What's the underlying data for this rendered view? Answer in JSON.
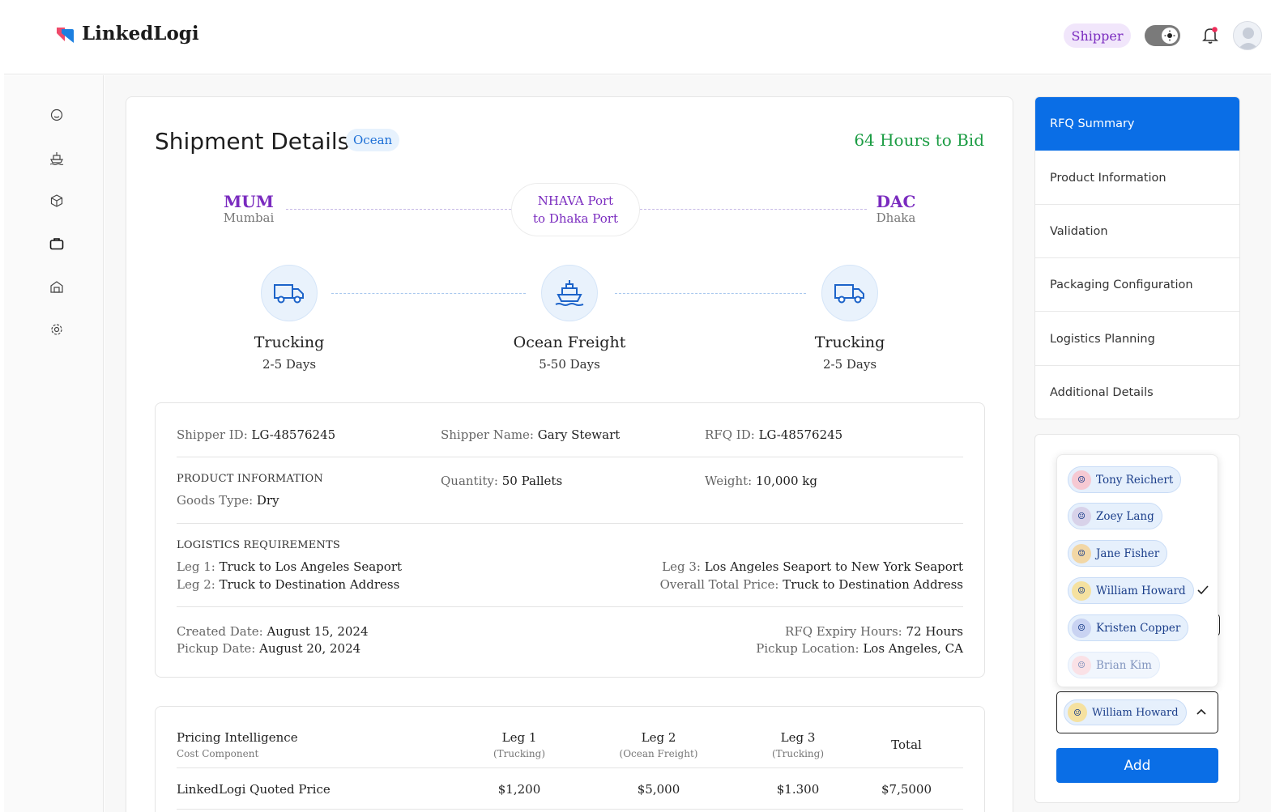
{
  "app": {
    "name": "LinkedLogi"
  },
  "header": {
    "role": "Shipper"
  },
  "shipment": {
    "title": "Shipment Details",
    "mode": "Ocean",
    "bid_timer": "64 Hours to Bid",
    "origin": {
      "code": "MUM",
      "city": "Mumbai"
    },
    "destination": {
      "code": "DAC",
      "city": "Dhaka"
    },
    "port_line1": "NHAVA Port",
    "port_line2": "to Dhaka Port",
    "legs": [
      {
        "name": "Trucking",
        "days": "2-5 Days",
        "icon": "truck-icon"
      },
      {
        "name": "Ocean Freight",
        "days": "5-50 Days",
        "icon": "ship-icon"
      },
      {
        "name": "Trucking",
        "days": "2-5 Days",
        "icon": "truck-icon"
      }
    ]
  },
  "info": {
    "shipper_id_label": "Shipper ID:",
    "shipper_id": "LG-48576245",
    "shipper_name_label": "Shipper Name:",
    "shipper_name": "Gary Stewart",
    "rfq_id_label": "RFQ ID:",
    "rfq_id": "LG-48576245",
    "product_heading": "PRODUCT INFORMATION",
    "goods_type_label": "Goods Type:",
    "goods_type": "Dry",
    "quantity_label": "Quantity:",
    "quantity": "50 Pallets",
    "weight_label": "Weight:",
    "weight": "10,000 kg",
    "logistics_heading": "LOGISTICS REQUIREMENTS",
    "leg1_label": "Leg 1:",
    "leg1": "Truck to Los Angeles Seaport",
    "leg2_label": "Leg 2:",
    "leg2": "Truck to Destination Address",
    "leg3_label": "Leg 3:",
    "leg3": "Los Angeles Seaport to New York Seaport",
    "overall_label": "Overall Total Price:",
    "overall": "Truck to Destination Address",
    "created_label": "Created Date:",
    "created": "August 15, 2024",
    "pickup_date_label": "Pickup Date:",
    "pickup_date": "August 20, 2024",
    "expiry_label": "RFQ Expiry Hours:",
    "expiry": "72 Hours",
    "pickup_loc_label": "Pickup Location:",
    "pickup_loc": "Los Angeles, CA"
  },
  "pricing": {
    "title": "Pricing Intelligence",
    "subtitle": "Cost Component",
    "columns": [
      {
        "label": "Leg 1",
        "sub": "(Trucking)"
      },
      {
        "label": "Leg 2",
        "sub": "(Ocean Freight)"
      },
      {
        "label": "Leg 3",
        "sub": "(Trucking)"
      },
      {
        "label": "Total",
        "sub": ""
      }
    ],
    "rows": [
      {
        "label": "LinkedLogi Quoted Price",
        "values": [
          "$1,200",
          "$5,000",
          "$1.300",
          "$7,5000"
        ]
      }
    ]
  },
  "nav": {
    "items": [
      "RFQ Summary",
      "Product Information",
      "Validation",
      "Packaging Configuration",
      "Logistics Planning",
      "Additional Details"
    ]
  },
  "assign": {
    "options": [
      "Tony Reichert",
      "Zoey Lang",
      "Jane Fisher",
      "William Howard",
      "Kristen Copper",
      "Brian Kim"
    ],
    "selected": "William Howard",
    "add_label": "Add"
  },
  "colors": {
    "accent": "#0a6ee6",
    "brand_purple": "#7a2bbf",
    "success": "#1b9c43"
  }
}
